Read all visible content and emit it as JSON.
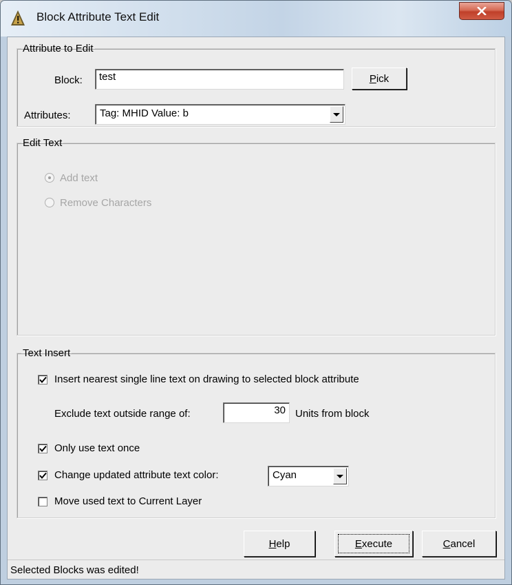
{
  "window": {
    "title": "Block Attribute Text Edit",
    "close_glyph": "X"
  },
  "attribute_group": {
    "legend": "Attribute to Edit",
    "block_label": "Block:",
    "block_value": "test",
    "pick_label_mn": "P",
    "pick_label_rest": "ick",
    "attributes_label": "Attributes:",
    "attributes_value": "Tag: MHID  Value: b"
  },
  "edit_text_group": {
    "legend": "Edit Text",
    "add_text_label": "Add text",
    "remove_label": "Remove Characters",
    "add_text_selected": true
  },
  "text_insert_group": {
    "legend": "Text Insert",
    "insert_nearest_label": "Insert nearest single line text on drawing to selected block attribute",
    "insert_nearest_checked": true,
    "exclude_label": "Exclude text outside range of:",
    "exclude_value": "30",
    "units_label": "Units from block",
    "only_once_label": "Only use text once",
    "only_once_checked": true,
    "change_color_label": "Change updated attribute text color:",
    "change_color_checked": true,
    "color_value": "Cyan",
    "move_layer_label": "Move used text to Current Layer",
    "move_layer_checked": false
  },
  "buttons": {
    "help_mn": "H",
    "help_rest": "elp",
    "execute_mn": "E",
    "execute_rest": "xecute",
    "cancel_mn": "C",
    "cancel_rest": "ancel"
  },
  "status_bar": {
    "message": "Selected Blocks was edited!"
  },
  "colors": {
    "accent_close": "#c0402a",
    "disabled_text": "#a6a6a6",
    "dialog_bg": "#ececec"
  },
  "icons": {
    "app": "warning-triangle-icon",
    "close": "close-icon",
    "dropdown": "chevron-down-icon",
    "check": "checkmark-icon"
  }
}
